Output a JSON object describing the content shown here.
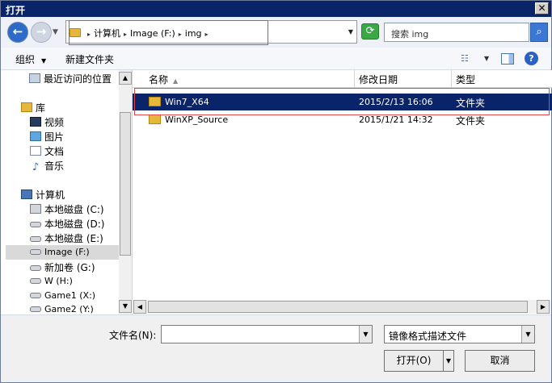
{
  "window": {
    "title": "打开",
    "close_glyph": "✕"
  },
  "address": {
    "crumbs": [
      "计算机",
      "Image (F:)",
      "img"
    ],
    "search_placeholder": "搜索 img"
  },
  "toolbar": {
    "organize": "组织",
    "new_folder": "新建文件夹"
  },
  "nav": {
    "recent": "最近访问的位置",
    "libraries": "库",
    "video": "视频",
    "pictures": "图片",
    "documents": "文档",
    "music": "音乐",
    "computer": "计算机",
    "drives": [
      "本地磁盘 (C:)",
      "本地磁盘 (D:)",
      "本地磁盘 (E:)",
      "Image (F:)",
      "新加卷 (G:)",
      "W (H:)",
      "Game1 (X:)",
      "Game2 (Y:)"
    ]
  },
  "columns": {
    "name": "名称",
    "date": "修改日期",
    "type": "类型"
  },
  "files": [
    {
      "name": "Win7_X64",
      "date": "2015/2/13 16:06",
      "type": "文件夹"
    },
    {
      "name": "WinXP_Source",
      "date": "2015/1/21 14:32",
      "type": "文件夹"
    }
  ],
  "bottom": {
    "filename_label": "文件名(N):",
    "filename_value": "",
    "filetype": "镜像格式描述文件",
    "open_button": "打开(O)",
    "cancel_button": "取消"
  },
  "colors": {
    "titlebar": "#0a246a",
    "selection": "#0a246a",
    "highlight_box": "#e04848"
  }
}
